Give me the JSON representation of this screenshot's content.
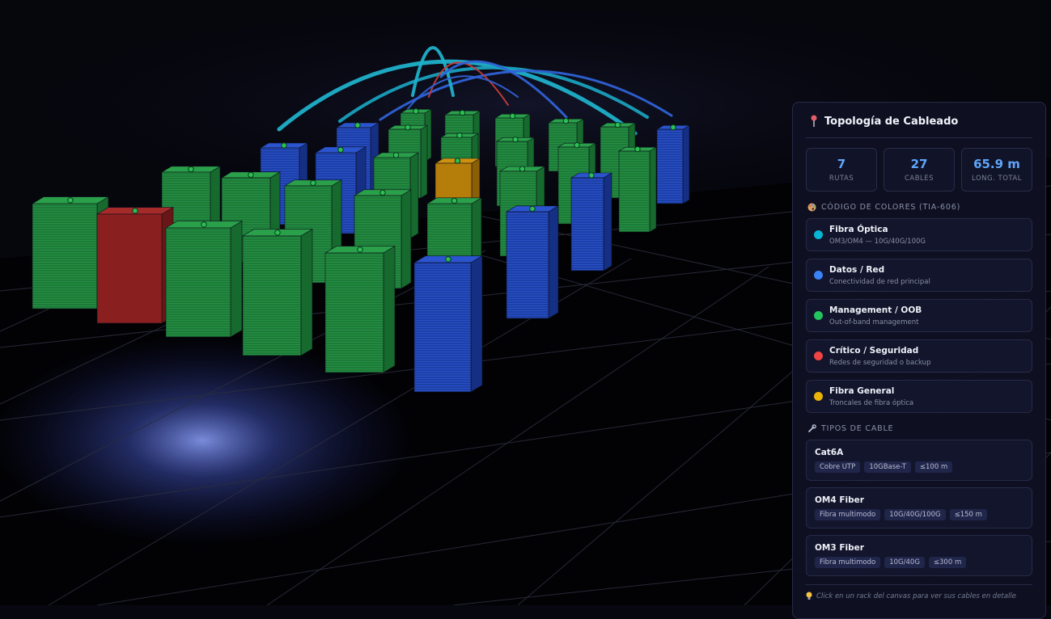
{
  "panel": {
    "title": "Topología de Cableado",
    "title_icon": "pushpin-icon",
    "stats": [
      {
        "value": "7",
        "label": "RUTAS"
      },
      {
        "value": "27",
        "label": "CABLES"
      },
      {
        "value": "65.9 m",
        "label": "LONG. TOTAL"
      }
    ],
    "color_code_title": "CÓDIGO DE COLORES (TIA-606)",
    "legend": [
      {
        "name": "Fibra Óptica",
        "desc": "OM3/OM4 — 10G/40G/100G",
        "color": "#06b6d4"
      },
      {
        "name": "Datos / Red",
        "desc": "Conectividad de red principal",
        "color": "#3b82f6"
      },
      {
        "name": "Management / OOB",
        "desc": "Out-of-band management",
        "color": "#22c55e"
      },
      {
        "name": "Crítico / Seguridad",
        "desc": "Redes de seguridad o backup",
        "color": "#ef4444"
      },
      {
        "name": "Fibra General",
        "desc": "Troncales de fibra óptica",
        "color": "#eab308"
      }
    ],
    "cable_types_title": "TIPOS DE CABLE",
    "cable_types": [
      {
        "name": "Cat6A",
        "tags": [
          "Cobre UTP",
          "10GBase-T",
          "≤100 m"
        ]
      },
      {
        "name": "OM4 Fiber",
        "tags": [
          "Fibra multimodo",
          "10G/40G/100G",
          "≤150 m"
        ]
      },
      {
        "name": "OM3 Fiber",
        "tags": [
          "Fibra multimodo",
          "10G/40G",
          "≤300 m"
        ]
      }
    ],
    "hint": "Click en un rack del canvas para ver sus cables en detalle"
  }
}
